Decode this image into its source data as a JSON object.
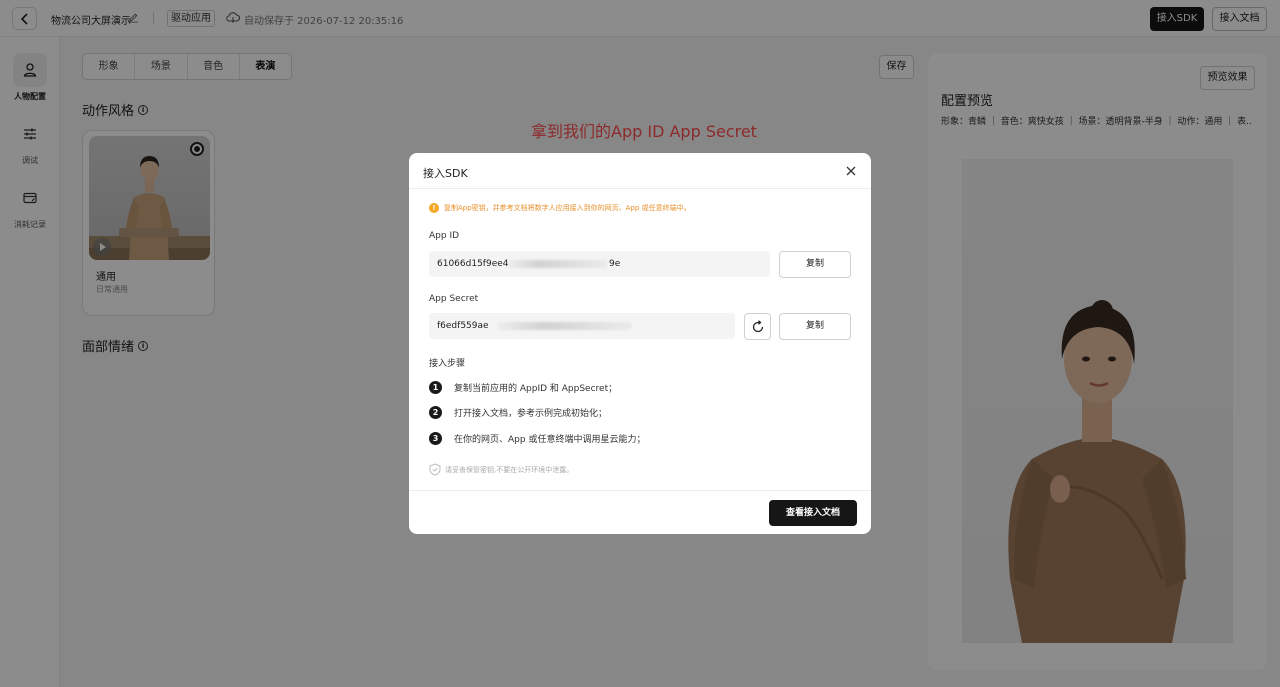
{
  "header": {
    "app_name": "物流公司大屏演示",
    "app_tag": "驱动应用",
    "autosave": "自动保存于 2026-07-12 20:35:16",
    "sdk_button": "接入SDK",
    "doc_button": "接入文档"
  },
  "rail": {
    "items": [
      {
        "label": "人物配置",
        "icon": "person-icon"
      },
      {
        "label": "调试",
        "icon": "sliders-icon"
      },
      {
        "label": "消耗记录",
        "icon": "wallet-icon"
      }
    ]
  },
  "tabs": [
    "形象",
    "场景",
    "音色",
    "表演"
  ],
  "save_button": "保存",
  "sections": {
    "motion_style": "动作风格",
    "facial_emotion": "面部情绪"
  },
  "motion_card": {
    "title": "通用",
    "subtitle": "日常通用"
  },
  "annotation": "拿到我们的App ID App Secret",
  "preview": {
    "button": "预览效果",
    "title": "配置预览",
    "meta": "形象：青鳞 ｜ 音色：爽快女孩 ｜ 场景：透明背景-半身 ｜ 动作：通用 ｜ 表..."
  },
  "modal": {
    "title": "接入SDK",
    "warning": "复制App密钥，并参考文档将数字人应用接入到你的网页、App 或任意终端中。",
    "app_id_label": "App ID",
    "app_id_value": "61066d15f9ee4",
    "app_id_tail": "9e",
    "app_secret_label": "App Secret",
    "app_secret_value": "f6edf559ae",
    "copy_label": "复制",
    "steps_title": "接入步骤",
    "steps": [
      "复制当前应用的 AppID 和 AppSecret；",
      "打开接入文档，参考示例完成初始化；",
      "在你的网页、App 或任意终端中调用星云能力；"
    ],
    "tip": "请妥善保管密钥,不要在公开环境中泄露。",
    "view_doc_button": "查看接入文档"
  },
  "colors": {
    "primary": "#161616",
    "annotation": "#ff4d4f",
    "warning": "#f5a623"
  }
}
